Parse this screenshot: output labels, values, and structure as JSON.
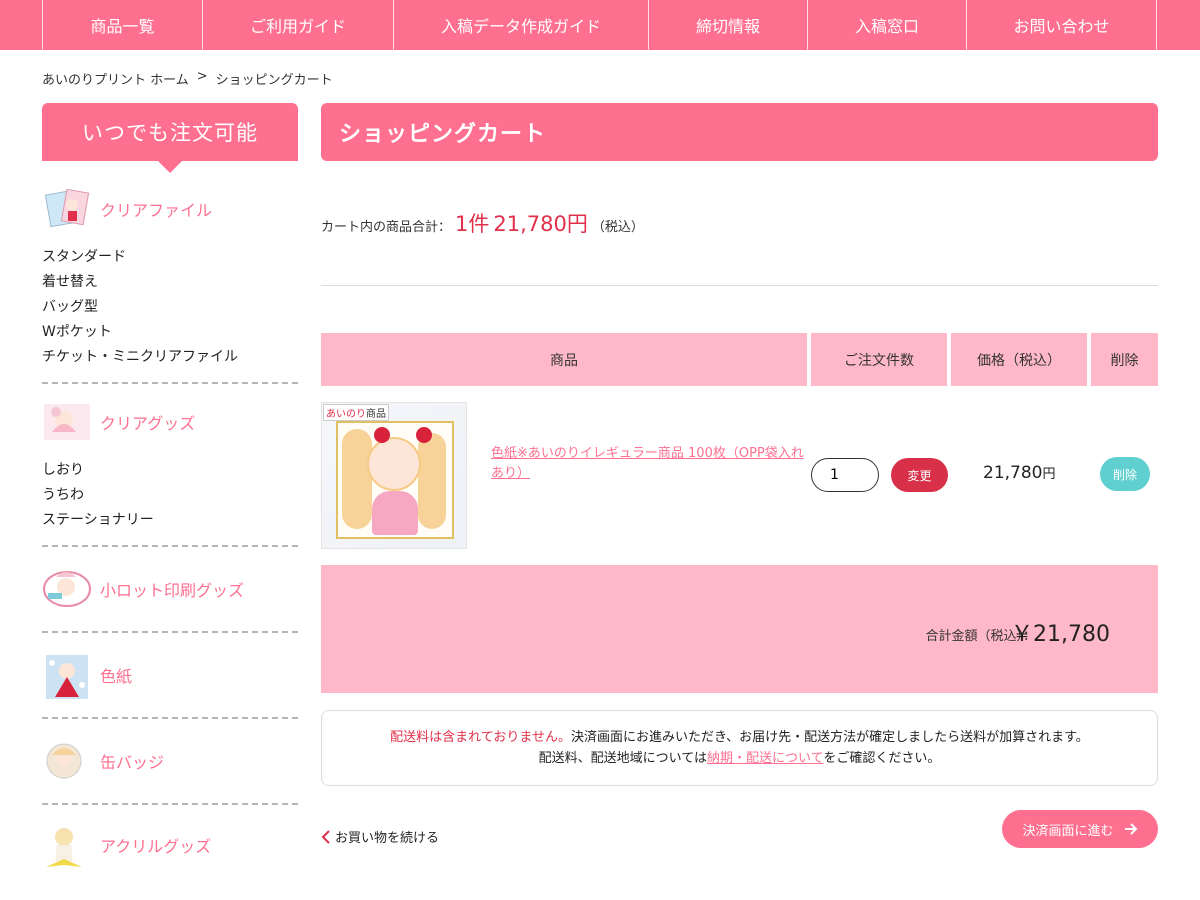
{
  "nav": {
    "items": [
      "商品一覧",
      "ご利用ガイド",
      "入稿データ作成ガイド",
      "締切情報",
      "入稿窓口",
      "お問い合わせ"
    ]
  },
  "breadcrumb": {
    "home": "あいのりプリント ホーム",
    "sep": ">",
    "current": "ショッピングカート"
  },
  "sidebar": {
    "heading": "いつでも注文可能",
    "categories": [
      {
        "name": "クリアファイル",
        "items": [
          "スタンダード",
          "着せ替え",
          "バッグ型",
          "Wポケット",
          "チケット・ミニクリアファイル"
        ]
      },
      {
        "name": "クリアグッズ",
        "items": [
          "しおり",
          "うちわ",
          "ステーショナリー"
        ]
      },
      {
        "name": "小ロット印刷グッズ",
        "items": []
      },
      {
        "name": "色紙",
        "items": []
      },
      {
        "name": "缶バッジ",
        "items": []
      },
      {
        "name": "アクリルグッズ",
        "items": []
      }
    ]
  },
  "main": {
    "title": "ショッピングカート",
    "summary": {
      "label": "カート内の商品合計：",
      "count": "1件",
      "amount": "21,780円",
      "tax": "（税込）"
    },
    "table": {
      "headers": [
        "商品",
        "ご注文件数",
        "価格（税込）",
        "削除"
      ],
      "rows": [
        {
          "thumb_tag_a": "あいのり",
          "thumb_tag_b": "商品",
          "name": "色紙※あいのりイレギュラー商品 100枚（OPP袋入れあり）",
          "quantity": "1",
          "change_label": "変更",
          "price": "21,780",
          "price_unit": "円",
          "delete_label": "削除"
        }
      ]
    },
    "total": {
      "label": "合計金額（税込）：",
      "value": "￥21,780"
    },
    "notice": {
      "red": "配送料は含まれておりません。",
      "line1": "決済画面にお進みいただき、お届け先・配送方法が確定しましたら送料が加算されます。",
      "line2_pre": "配送料、配送地域については",
      "line2_link": "納期・配送について",
      "line2_post": "をご確認ください。"
    },
    "continue_label": "お買い物を続ける",
    "checkout_label": "決済画面に進む"
  },
  "colors": {
    "accent": "#ff7090",
    "header_pink": "#ffb8c8",
    "red": "#e2304a",
    "delete": "#5fd0cf"
  },
  "icons": {
    "continue": "chevron-left-icon",
    "checkout": "arrow-right-icon"
  }
}
